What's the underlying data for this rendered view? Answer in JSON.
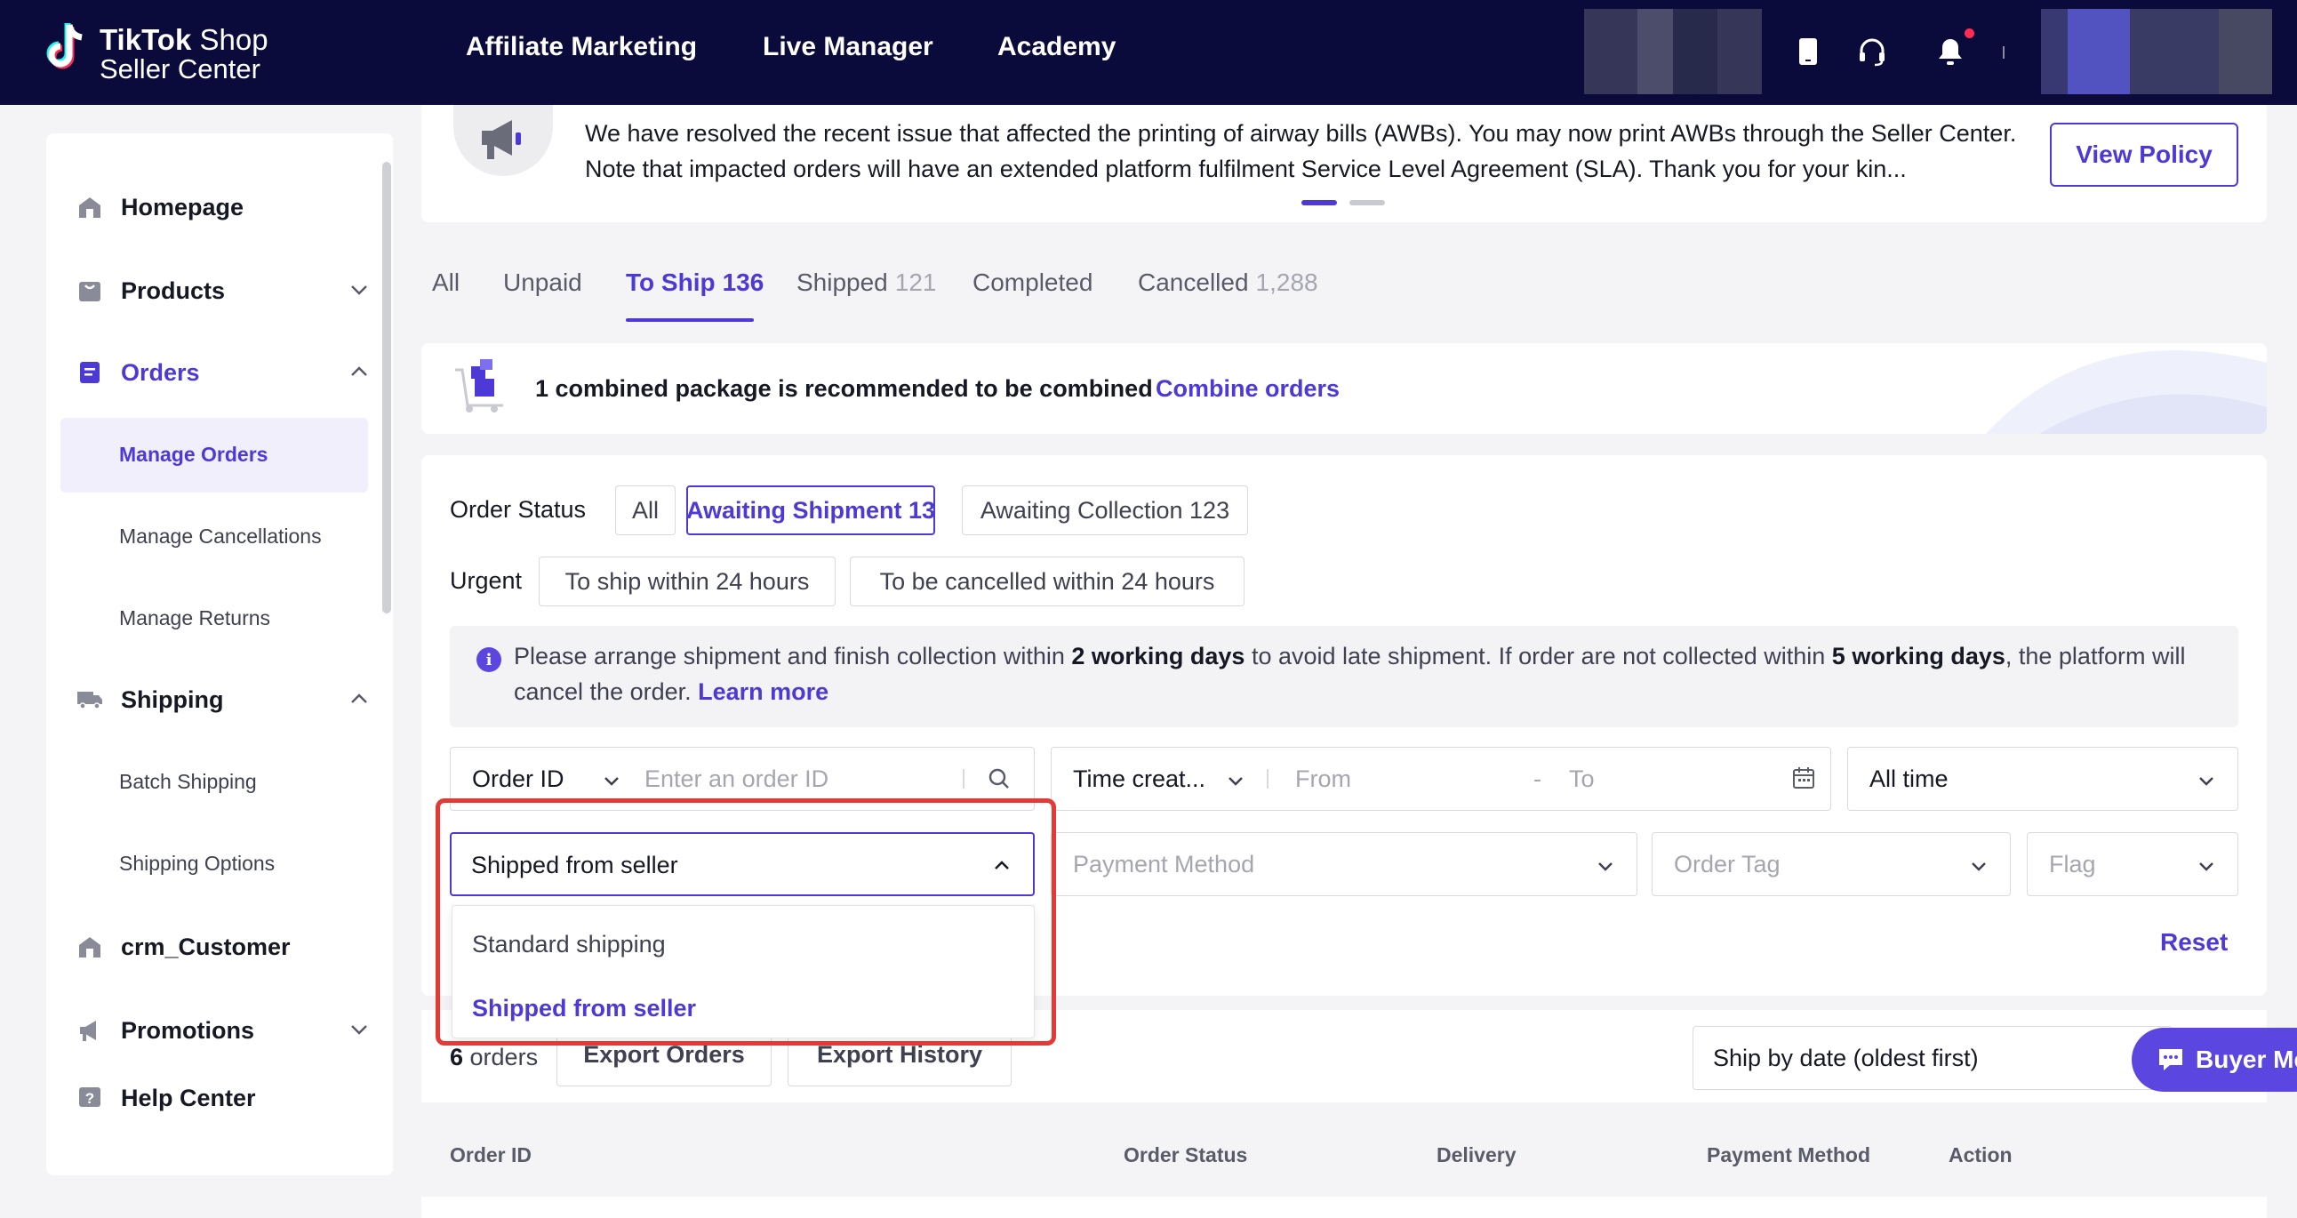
{
  "brand": {
    "line1_bold": "TikTok",
    "line1_light": " Shop",
    "line2": "Seller Center"
  },
  "topnav": [
    "Affiliate Marketing",
    "Live Manager",
    "Academy"
  ],
  "sidebar": {
    "items": [
      {
        "label": "Homepage",
        "icon": "home-icon"
      },
      {
        "label": "Products",
        "icon": "bag-icon"
      },
      {
        "label": "Orders",
        "icon": "orders-icon"
      },
      {
        "label": "Shipping",
        "icon": "truck-icon"
      },
      {
        "label": "crm_Customer",
        "icon": "home-icon"
      },
      {
        "label": "Promotions",
        "icon": "megaphone-icon"
      },
      {
        "label": "Help Center",
        "icon": "help-icon"
      }
    ],
    "orders_sub": [
      "Manage Orders",
      "Manage Cancellations",
      "Manage Returns"
    ],
    "shipping_sub": [
      "Batch Shipping",
      "Shipping Options"
    ]
  },
  "announcement": {
    "text": "We have resolved the recent issue that affected the printing of airway bills (AWBs). You may now print AWBs through the Seller Center. Note that impacted orders will have an extended platform fulfilment Service Level Agreement (SLA). Thank you for your kin...",
    "button": "View Policy"
  },
  "tabs": [
    {
      "label": "All",
      "count": ""
    },
    {
      "label": "Unpaid",
      "count": ""
    },
    {
      "label": "To Ship",
      "count": "136"
    },
    {
      "label": "Shipped",
      "count": "121"
    },
    {
      "label": "Completed",
      "count": ""
    },
    {
      "label": "Cancelled",
      "count": "1,288"
    }
  ],
  "combine": {
    "text": "1 combined package is recommended to be combined",
    "link": "Combine orders"
  },
  "filters": {
    "order_status_label": "Order Status",
    "status_chips": [
      "All",
      "Awaiting Shipment 13",
      "Awaiting Collection 123"
    ],
    "urgent_label": "Urgent",
    "urgent_chips": [
      "To ship within 24 hours",
      "To be cancelled within 24 hours"
    ],
    "info": {
      "p1": "Please arrange shipment and finish collection within ",
      "b1": "2 working days",
      "p2": " to avoid late shipment. If order are not collected within ",
      "b2": "5 working days",
      "p3": ", the platform will cancel the order. ",
      "link": "Learn more"
    },
    "order_id_select": "Order ID",
    "order_id_placeholder": "Enter an order ID",
    "time_select": "Time creat...",
    "from_placeholder": "From",
    "to_placeholder": "To",
    "range_select": "All time",
    "shipping_select": "Shipped from seller",
    "shipping_options": [
      "Standard shipping",
      "Shipped from seller"
    ],
    "payment_placeholder": "Payment Method",
    "tag_placeholder": "Order Tag",
    "flag_placeholder": "Flag",
    "reset": "Reset"
  },
  "orders_bar": {
    "count": "6",
    "count_suffix": " orders",
    "export_orders": "Export Orders",
    "export_history": "Export History",
    "sort": "Ship by date (oldest first)",
    "buyer_messages": "Buyer Me"
  },
  "table_headers": [
    "Order ID",
    "Order Status",
    "Delivery",
    "Payment Method",
    "Action"
  ],
  "colors": {
    "accent": "#4d3ad6",
    "nav_bg": "#0a0b3a",
    "highlight": "#e53935"
  }
}
